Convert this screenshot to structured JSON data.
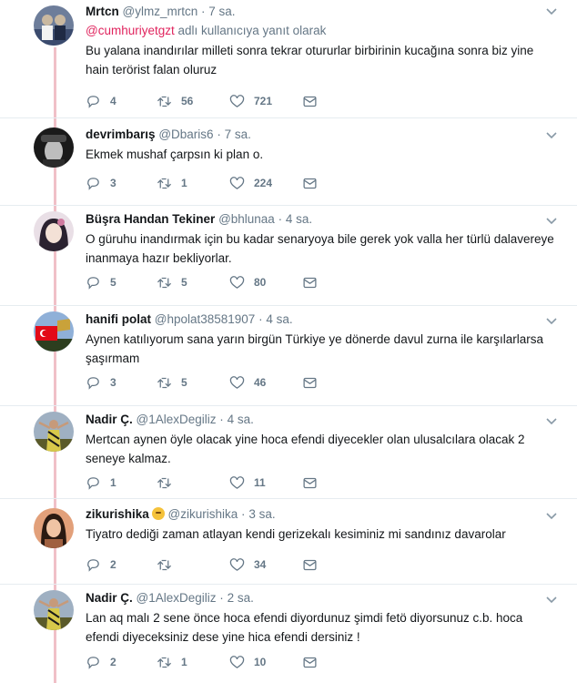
{
  "tweets": [
    {
      "name": "Mrtcn",
      "handle": "@ylmz_mrtcn",
      "time": "7 sa.",
      "reply_mention": "@cumhuriyetgzt",
      "reply_suffix": " adlı kullanıcıya yanıt olarak",
      "text": "Bu yalana inandırılar milleti sonra tekrar otururlar birbirinin kucağına sonra biz yine hain terörist falan oluruz",
      "replies": "4",
      "retweets": "56",
      "likes": "721",
      "avatar_colors": [
        "#6d7d9a",
        "#c9b8a0",
        "#3b4b6e"
      ]
    },
    {
      "name": "devrimbarış",
      "handle": "@Dbaris6",
      "time": "7 sa.",
      "text": "Ekmek mushaf çarpsın ki plan o.",
      "replies": "3",
      "retweets": "1",
      "likes": "224",
      "avatar_colors": [
        "#1a1a1a",
        "#bdbdbd",
        "#4a4a4a"
      ]
    },
    {
      "name": "Büşra Handan Tekiner",
      "handle": "@bhlunaa",
      "time": "4 sa.",
      "text": "O güruhu inandırmak için bu kadar senaryoya bile gerek yok valla her türlü dalavereye inanmaya hazır bekliyorlar.",
      "replies": "5",
      "retweets": "5",
      "likes": "80",
      "avatar_colors": [
        "#e9dfe6",
        "#2b2230",
        "#d07aa0"
      ]
    },
    {
      "name": "hanifi polat",
      "handle": "@hpolat38581907",
      "time": "4 sa.",
      "text": "Aynen katılıyorum sana yarın birgün Türkiye ye dönerde davul zurna ile karşılarlarsa şaşırmam",
      "replies": "3",
      "retweets": "5",
      "likes": "46",
      "avatar_colors": [
        "#8fb0d8",
        "#e30a17",
        "#2d3e1f"
      ]
    },
    {
      "name": "Nadir Ç.",
      "handle": "@1AlexDegiliz",
      "time": "4 sa.",
      "text": "Mertcan aynen öyle olacak yine hoca efendi diyecekler olan ulusalcılara olacak 2 seneye kalmaz.",
      "replies": "1",
      "retweets": "",
      "likes": "11",
      "avatar_colors": [
        "#9fb0c2",
        "#d7c84a",
        "#5a5a2a"
      ]
    },
    {
      "name": "zikurishika",
      "handle": "@zikurishika",
      "time": "3 sa.",
      "text": "Tiyatro dediği zaman atlayan kendi gerizekalı kesiminiz mi sandınız davarolar",
      "replies": "2",
      "retweets": "",
      "likes": "34",
      "avatar_colors": [
        "#e2a07a",
        "#2a1a12",
        "#a06040"
      ]
    },
    {
      "name": "Nadir Ç.",
      "handle": "@1AlexDegiliz",
      "time": "2 sa.",
      "text": "Lan aq malı 2 sene önce hoca efendi diyordunuz şimdi fetö diyorsunuz c.b. hoca efendi diyeceksiniz dese yine hica efendi dersiniz !",
      "replies": "2",
      "retweets": "1",
      "likes": "10",
      "avatar_colors": [
        "#9fb0c2",
        "#d7c84a",
        "#5a5a2a"
      ]
    }
  ],
  "ui": {
    "accent": "#e0245e",
    "thread_line": "#f0c0c8",
    "icons": [
      "reply-icon",
      "retweet-icon",
      "like-icon",
      "message-icon",
      "chevron-down-icon"
    ]
  }
}
